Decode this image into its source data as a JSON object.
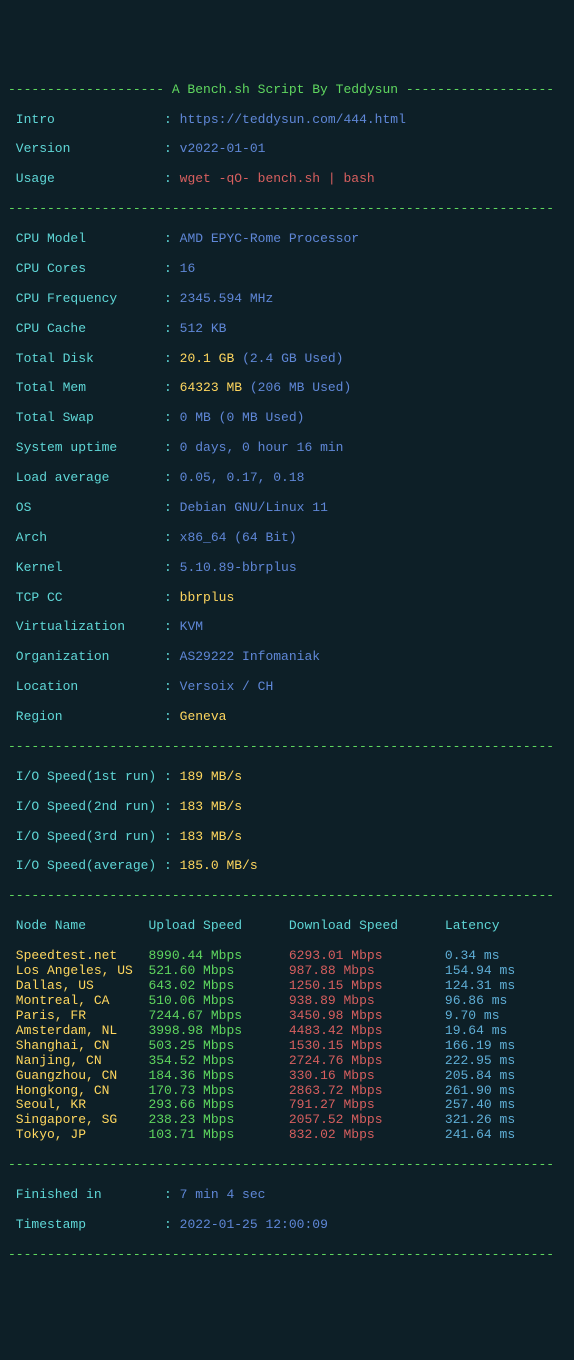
{
  "header": {
    "title": "-------------------- A Bench.sh Script By Teddysun -------------------",
    "intro_label": " Intro              : ",
    "intro_value": "https://teddysun.com/444.html",
    "version_label": " Version            : ",
    "version_value": "v2022-01-01",
    "usage_label": " Usage              : ",
    "usage_value": "wget -qO- bench.sh | bash"
  },
  "divider": "----------------------------------------------------------------------",
  "cpu": {
    "model_label": " CPU Model          : ",
    "model_value": "AMD EPYC-Rome Processor",
    "cores_label": " CPU Cores          : ",
    "cores_value": "16",
    "freq_label": " CPU Frequency      : ",
    "freq_value": "2345.594 MHz",
    "cache_label": " CPU Cache          : ",
    "cache_value": "512 KB",
    "disk_label": " Total Disk         : ",
    "disk_value": "20.1 GB ",
    "disk_used": "(2.4 GB Used)",
    "mem_label": " Total Mem          : ",
    "mem_value": "64323 MB ",
    "mem_used": "(206 MB Used)",
    "swap_label": " Total Swap         : ",
    "swap_value": "0 MB (0 MB Used)",
    "uptime_label": " System uptime      : ",
    "uptime_value": "0 days, 0 hour 16 min",
    "load_label": " Load average       : ",
    "load_value": "0.05, 0.17, 0.18",
    "os_label": " OS                 : ",
    "os_value": "Debian GNU/Linux 11",
    "arch_label": " Arch               : ",
    "arch_value": "x86_64 (64 Bit)",
    "kernel_label": " Kernel             : ",
    "kernel_value": "5.10.89-bbrplus",
    "tcp_label": " TCP CC             : ",
    "tcp_value": "bbrplus",
    "virt_label": " Virtualization     : ",
    "virt_value": "KVM",
    "org_label": " Organization       : ",
    "org_value": "AS29222 Infomaniak",
    "loc_label": " Location           : ",
    "loc_value": "Versoix / CH",
    "region_label": " Region             : ",
    "region_value": "Geneva"
  },
  "io": {
    "r1_label": " I/O Speed(1st run) : ",
    "r1_value": "189 MB/s",
    "r2_label": " I/O Speed(2nd run) : ",
    "r2_value": "183 MB/s",
    "r3_label": " I/O Speed(3rd run) : ",
    "r3_value": "183 MB/s",
    "avg_label": " I/O Speed(average) : ",
    "avg_value": "185.0 MB/s"
  },
  "net": {
    "header_node": " Node Name        ",
    "header_up": "Upload Speed      ",
    "header_down": "Download Speed      ",
    "header_lat": "Latency     ",
    "rows": [
      {
        "node": " Speedtest.net    ",
        "up": "8990.44 Mbps      ",
        "down": "6293.01 Mbps        ",
        "lat": "0.34 ms     "
      },
      {
        "node": " Los Angeles, US  ",
        "up": "521.60 Mbps       ",
        "down": "987.88 Mbps         ",
        "lat": "154.94 ms   "
      },
      {
        "node": " Dallas, US       ",
        "up": "643.02 Mbps       ",
        "down": "1250.15 Mbps        ",
        "lat": "124.31 ms   "
      },
      {
        "node": " Montreal, CA     ",
        "up": "510.06 Mbps       ",
        "down": "938.89 Mbps         ",
        "lat": "96.86 ms    "
      },
      {
        "node": " Paris, FR        ",
        "up": "7244.67 Mbps      ",
        "down": "3450.98 Mbps        ",
        "lat": "9.70 ms     "
      },
      {
        "node": " Amsterdam, NL    ",
        "up": "3998.98 Mbps      ",
        "down": "4483.42 Mbps        ",
        "lat": "19.64 ms    "
      },
      {
        "node": " Shanghai, CN     ",
        "up": "503.25 Mbps       ",
        "down": "1530.15 Mbps        ",
        "lat": "166.19 ms   "
      },
      {
        "node": " Nanjing, CN      ",
        "up": "354.52 Mbps       ",
        "down": "2724.76 Mbps        ",
        "lat": "222.95 ms   "
      },
      {
        "node": " Guangzhou, CN    ",
        "up": "184.36 Mbps       ",
        "down": "330.16 Mbps         ",
        "lat": "205.84 ms   "
      },
      {
        "node": " Hongkong, CN     ",
        "up": "170.73 Mbps       ",
        "down": "2863.72 Mbps        ",
        "lat": "261.90 ms   "
      },
      {
        "node": " Seoul, KR        ",
        "up": "293.66 Mbps       ",
        "down": "791.27 Mbps         ",
        "lat": "257.40 ms   "
      },
      {
        "node": " Singapore, SG    ",
        "up": "238.23 Mbps       ",
        "down": "2057.52 Mbps        ",
        "lat": "321.26 ms   "
      },
      {
        "node": " Tokyo, JP        ",
        "up": "103.71 Mbps       ",
        "down": "832.02 Mbps         ",
        "lat": "241.64 ms   "
      }
    ]
  },
  "footer": {
    "finished_label": " Finished in        : ",
    "finished_value": "7 min 4 sec",
    "timestamp_label": " Timestamp          : ",
    "timestamp_value": "2022-01-25 12:00:09"
  }
}
